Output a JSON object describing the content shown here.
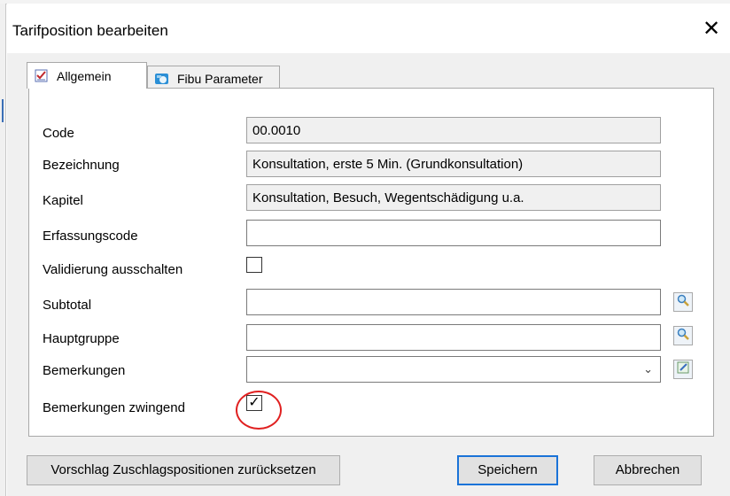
{
  "dialog": {
    "title": "Tarifposition bearbeiten",
    "close_glyph": "✕"
  },
  "tabs": [
    {
      "label": "Allgemein",
      "icon": "checklist-icon",
      "selected": true
    },
    {
      "label": "Fibu Parameter",
      "icon": "fibu-icon",
      "selected": false
    }
  ],
  "form": {
    "code": {
      "label": "Code",
      "value": "00.0010"
    },
    "bezeichnung": {
      "label": "Bezeichnung",
      "value": "Konsultation, erste 5 Min. (Grundkonsultation)"
    },
    "kapitel": {
      "label": "Kapitel",
      "value": "Konsultation, Besuch, Wegentschädigung u.a."
    },
    "erfassungscode": {
      "label": "Erfassungscode",
      "value": ""
    },
    "validierung": {
      "label": "Validierung ausschalten",
      "checked": false
    },
    "subtotal": {
      "label": "Subtotal",
      "value": ""
    },
    "hauptgruppe": {
      "label": "Hauptgruppe",
      "value": ""
    },
    "bemerkungen": {
      "label": "Bemerkungen",
      "value": ""
    },
    "bemerkungen_zwingend": {
      "label": "Bemerkungen zwingend",
      "checked": true
    }
  },
  "buttons": {
    "reset": "Vorschlag Zuschlagspositionen zurücksetzen",
    "save": "Speichern",
    "cancel": "Abbrechen"
  },
  "colors": {
    "accent": "#1a73d8",
    "highlight_circle": "#e02020"
  }
}
